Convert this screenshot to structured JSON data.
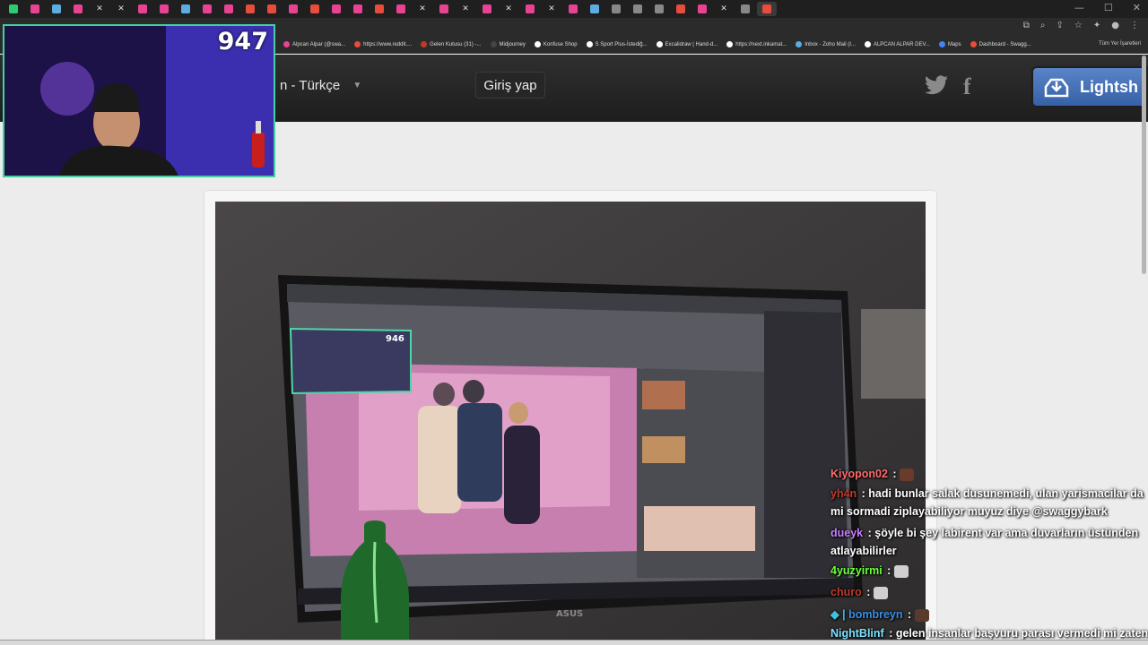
{
  "browser": {
    "tab_count_icons": [
      "X",
      "X",
      "X",
      "X",
      "X",
      "X",
      "X",
      "X",
      "X",
      "X",
      "X",
      "X"
    ],
    "bookmarks": [
      "Alpcan Alpar (@swa...",
      "https://www.reddit....",
      "Gelen Kutusu (31) -...",
      "Midjourney",
      "Konfuse Shop",
      "S Sport Plus-İstediğ...",
      "Excalidraw | Hand-d...",
      "https://next.inkamat...",
      "Inbox - Zoho Mail (I...",
      "ALPCAN ALPAR DEV...",
      "Maps",
      "Dashboard - Swagg..."
    ],
    "all_bookmarks_label": "Tüm Yer İşaretleri"
  },
  "site": {
    "language_label": "n - Türkçe",
    "login_label": "Giriş yap",
    "lightshot_label": "Lightsh",
    "twitter_icon": "twitter-icon",
    "facebook_icon": "facebook-icon"
  },
  "stream": {
    "counter": "947",
    "inner_counter": "946",
    "inner_brand": "ASUS"
  },
  "chat": [
    {
      "user": "Kiyopon02",
      "sep": " : ",
      "text": "",
      "color": "#ff6b6b"
    },
    {
      "user": "yh4n",
      "sep": " : ",
      "text": "hadi bunlar salak dusunemedi, ulan yarismacilar da",
      "color": "#c0392b"
    },
    {
      "user": "",
      "sep": "",
      "text": "mi sormadi ziplayabiliyor muyuz diye @swaggybark",
      "color": "#ffffff"
    },
    {
      "user": "dueyk",
      "sep": " : ",
      "text": "şöyle bi şey labirent var ama duvarların üstünden",
      "color": "#c77dff"
    },
    {
      "user": "",
      "sep": "",
      "text": "atlayabilirler",
      "color": "#ffffff"
    },
    {
      "user": "4yuzyirmi",
      "sep": " : ",
      "text": "",
      "color": "#6aff3a"
    },
    {
      "user": "churo",
      "sep": " : ",
      "text": "",
      "color": "#c0392b"
    },
    {
      "user": "bombreyn",
      "sep": " : ",
      "text": "",
      "color": "#3b8fe0"
    },
    {
      "user": "NightBlinf",
      "sep": " : ",
      "text": "gelen insanlar başvuru parası vermedi mi zaten",
      "color": "#7ee0ff"
    }
  ]
}
